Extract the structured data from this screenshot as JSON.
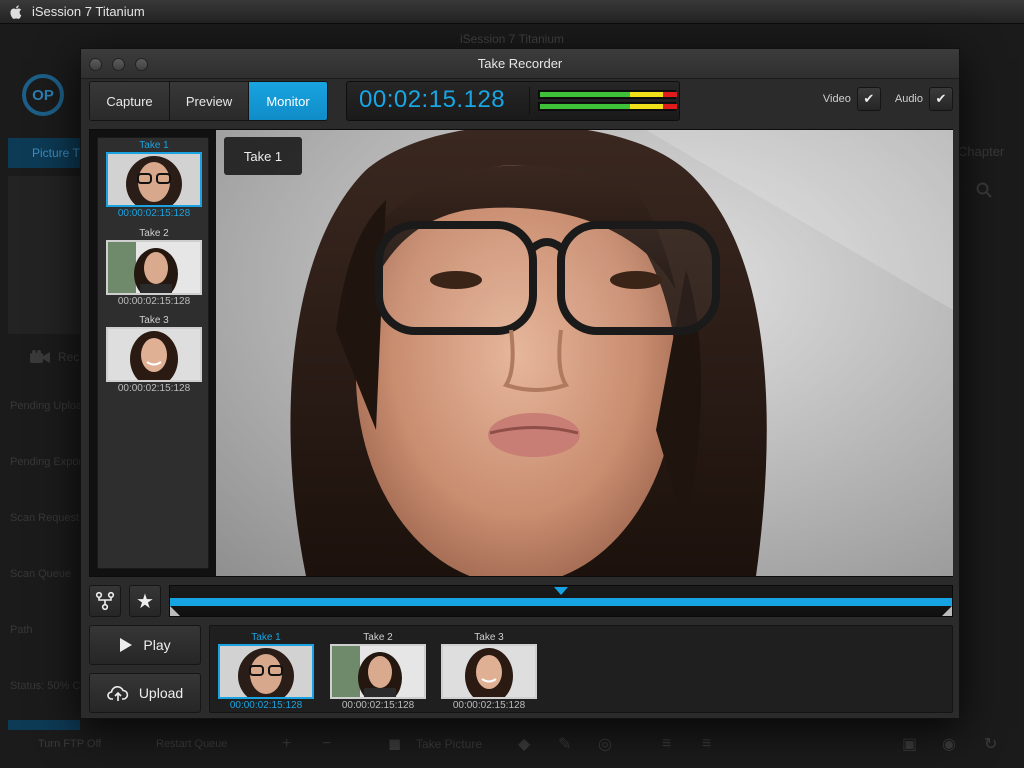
{
  "menubar": {
    "app_name": "iSession 7 Titanium"
  },
  "background_app": {
    "title": "iSession 7 Titanium",
    "logo_text": "OP",
    "tab_label": "Picture T",
    "rec_label": "Rec",
    "chapter_label": "Chapter",
    "list_items": [
      "Pending Uploa",
      "Pending Expor",
      "Scan Requests",
      "Scan Queue",
      "Path",
      "Status: 50% C"
    ],
    "toolbar": {
      "ftp": "Turn FTP Off",
      "restart": "Restart Queue",
      "take_picture": "Take Picture"
    }
  },
  "window": {
    "title": "Take Recorder",
    "tabs": [
      {
        "label": "Capture",
        "active": false
      },
      {
        "label": "Preview",
        "active": false
      },
      {
        "label": "Monitor",
        "active": true
      }
    ],
    "timecode": "00:02:15.128",
    "toggles": {
      "video_label": "Video",
      "audio_label": "Audio",
      "video_checked": true,
      "audio_checked": true
    },
    "badge": "Take 1",
    "takes": [
      {
        "label": "Take 1",
        "time": "00:00:02:15:128",
        "selected": true
      },
      {
        "label": "Take 2",
        "time": "00:00:02:15:128",
        "selected": false
      },
      {
        "label": "Take 3",
        "time": "00:00:02:15:128",
        "selected": false
      }
    ],
    "timeline": {
      "position": 0.5,
      "fill": 1.0
    },
    "play_label": "Play",
    "upload_label": "Upload"
  },
  "colors": {
    "accent": "#16a3e2",
    "meter_green": "#3fc23a",
    "meter_yellow": "#f0e11a",
    "meter_red": "#e01b1b"
  },
  "meters": [
    {
      "green": 0.66,
      "yellow": 0.24,
      "red": 0.1
    },
    {
      "green": 0.66,
      "yellow": 0.24,
      "red": 0.1
    }
  ]
}
